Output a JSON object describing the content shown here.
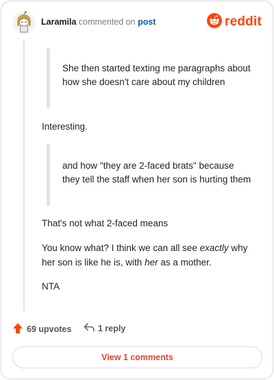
{
  "header": {
    "username": "Laramila",
    "action_text": "commented on",
    "post_link": "post",
    "brand_name": "reddit",
    "brand_color": "#ff4500",
    "avatar_icon": "snoo-avatar-icon"
  },
  "comment": {
    "quote1": "She then started texting me paragraphs about how she doesn't care about my children",
    "reply1": "Interesting.",
    "quote2": "and how \"they are 2-faced brats\" because they tell the staff when her son is hurting them",
    "reply2": "That's not what 2-faced means",
    "reply3_part1": "You know what? I think we can all see ",
    "reply3_em1": "exactly",
    "reply3_part2": " why her son is like he is, with ",
    "reply3_em2": "her",
    "reply3_part3": " as a mother.",
    "reply4": "NTA"
  },
  "actions": {
    "upvotes_label": "69 upvotes",
    "upvote_icon": "upvote-arrow-icon",
    "upvote_color": "#ff4500",
    "reply_label": "1 reply",
    "reply_icon": "reply-arrow-icon"
  },
  "footer": {
    "view_comments_label": "View 1 comments",
    "view_comments_color": "#e0432e"
  }
}
